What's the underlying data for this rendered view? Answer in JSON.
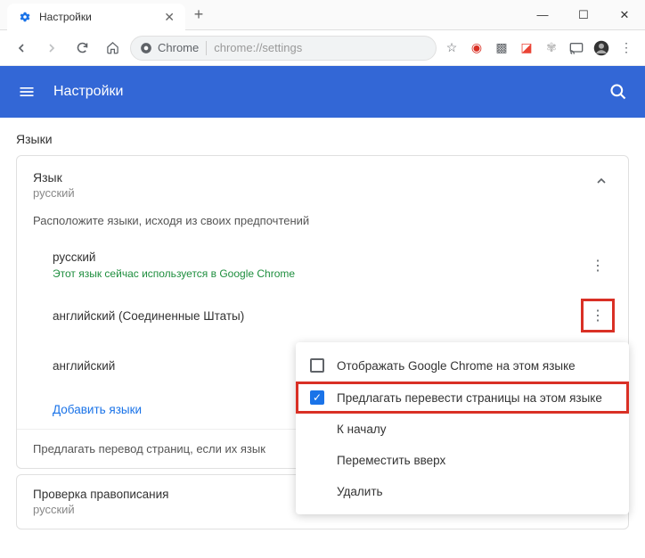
{
  "window": {
    "tab_title": "Настройки",
    "minimize": "—",
    "maximize": "☐",
    "close": "✕"
  },
  "toolbar": {
    "chrome_chip": "Chrome",
    "url": "chrome://settings"
  },
  "header": {
    "title": "Настройки"
  },
  "section": {
    "label": "Языки"
  },
  "langcard": {
    "title": "Язык",
    "subtitle": "русский",
    "instruction": "Расположите языки, исходя из своих предпочтений",
    "items": [
      {
        "name": "русский",
        "note": "Этот язык сейчас используется в Google Chrome"
      },
      {
        "name": "английский (Соединенные Штаты)"
      },
      {
        "name": "английский"
      }
    ],
    "add": "Добавить языки",
    "offer": "Предлагать перевод страниц, если их язык"
  },
  "spell": {
    "title": "Проверка правописания",
    "subtitle": "русский"
  },
  "menu": {
    "display": "Отображать Google Chrome на этом языке",
    "offer": "Предлагать перевести страницы на этом языке",
    "top": "К началу",
    "up": "Переместить вверх",
    "delete": "Удалить"
  }
}
